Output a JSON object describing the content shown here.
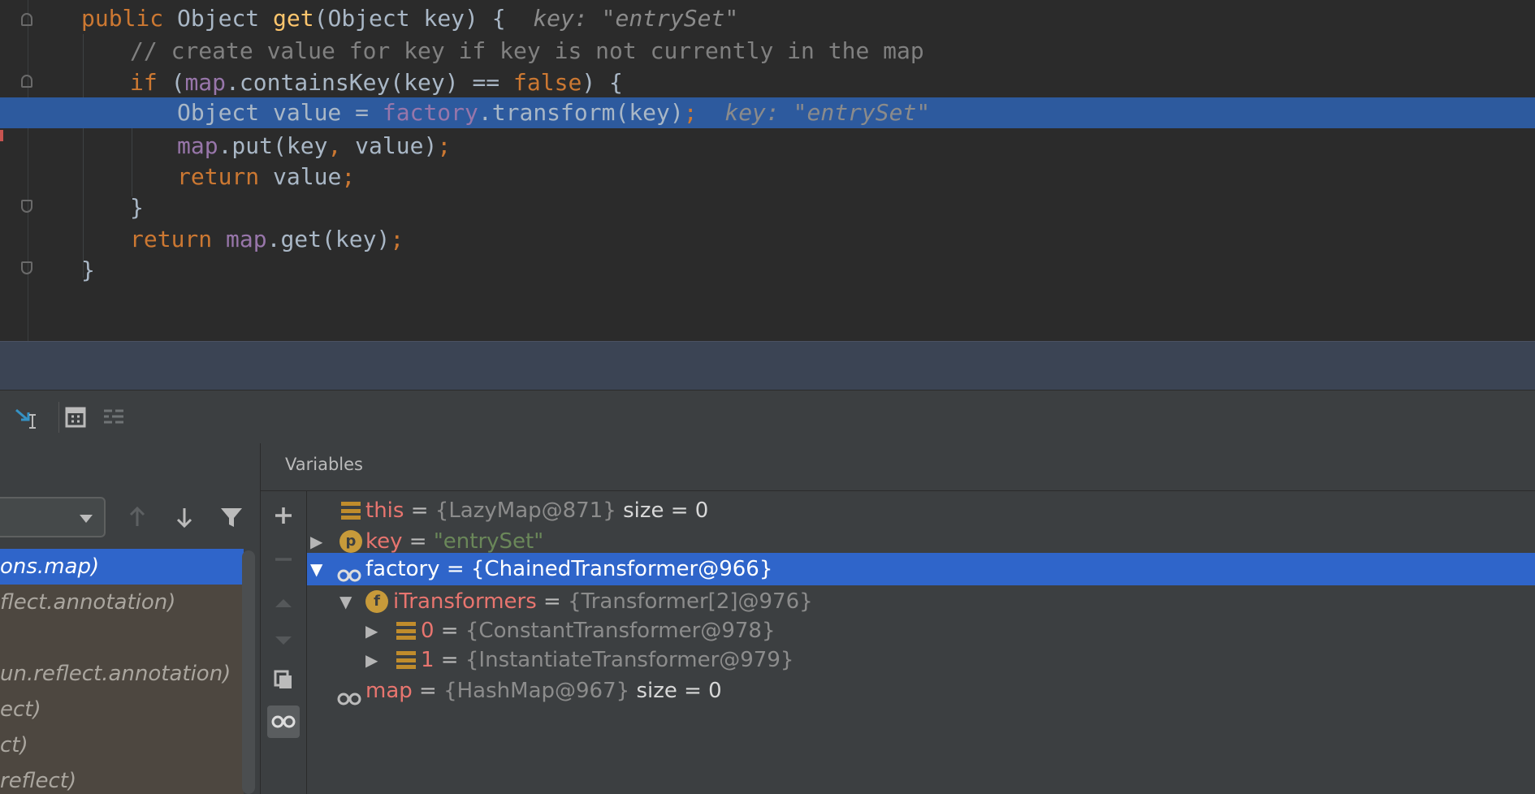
{
  "editor": {
    "lines": [
      {
        "tokens": [
          {
            "t": "public ",
            "c": "kw"
          },
          {
            "t": "Object ",
            "c": ""
          },
          {
            "t": "get",
            "c": "fn"
          },
          {
            "t": "(Object key) {  ",
            "c": ""
          },
          {
            "t": "key: \"entrySet\"",
            "c": "hint"
          }
        ]
      },
      {
        "tokens": [
          {
            "t": "// create value for key if key is not currently in the map",
            "c": "cmt"
          }
        ]
      },
      {
        "tokens": [
          {
            "t": "if ",
            "c": "kw"
          },
          {
            "t": "(",
            "c": ""
          },
          {
            "t": "map",
            "c": "fld"
          },
          {
            "t": ".containsKey(key) == ",
            "c": ""
          },
          {
            "t": "false",
            "c": "kw"
          },
          {
            "t": ") {",
            "c": ""
          }
        ]
      },
      {
        "tokens": [
          {
            "t": "Object value = ",
            "c": ""
          },
          {
            "t": "factory",
            "c": "fld"
          },
          {
            "t": ".transform(key)",
            "c": ""
          },
          {
            "t": ";",
            "c": "kw"
          },
          {
            "t": "  ",
            "c": ""
          },
          {
            "t": "key: \"entrySet\"",
            "c": "hint"
          }
        ]
      },
      {
        "tokens": [
          {
            "t": "map",
            "c": "fld"
          },
          {
            "t": ".put(key",
            "c": ""
          },
          {
            "t": ",",
            "c": "kw"
          },
          {
            "t": " value)",
            "c": ""
          },
          {
            "t": ";",
            "c": "kw"
          }
        ]
      },
      {
        "tokens": [
          {
            "t": "return ",
            "c": "kw"
          },
          {
            "t": "value",
            "c": ""
          },
          {
            "t": ";",
            "c": "kw"
          }
        ]
      },
      {
        "tokens": [
          {
            "t": "}",
            "c": ""
          }
        ]
      },
      {
        "tokens": [
          {
            "t": "return ",
            "c": "kw"
          },
          {
            "t": "map",
            "c": "fld"
          },
          {
            "t": ".get(key)",
            "c": ""
          },
          {
            "t": ";",
            "c": "kw"
          }
        ]
      },
      {
        "tokens": [
          {
            "t": "}",
            "c": ""
          }
        ]
      }
    ]
  },
  "frames": {
    "items": [
      "ons.map)",
      "flect.annotation)",
      "",
      "un.reflect.annotation)",
      "ect)",
      "ct)",
      "reflect)"
    ]
  },
  "variables": {
    "title": "Variables",
    "rows": [
      {
        "icon": "field-list-icon",
        "name": "this",
        "op": " = ",
        "value": "{LazyMap@871}",
        "extra": "  size = 0",
        "str": false
      },
      {
        "icon": "parameter-icon",
        "name": "key",
        "op": " = ",
        "value": "\"entrySet\"",
        "extra": "",
        "str": true
      },
      {
        "icon": "watch-icon",
        "name": "factory",
        "op": " = ",
        "value": "{ChainedTransformer@966}",
        "extra": "",
        "str": false
      },
      {
        "icon": "field-icon",
        "name": "iTransformers",
        "op": " = ",
        "value": "{Transformer[2]@976}",
        "extra": "",
        "str": false
      },
      {
        "icon": "field-list-icon",
        "name": "0",
        "op": " = ",
        "value": "{ConstantTransformer@978}",
        "extra": "",
        "str": false
      },
      {
        "icon": "field-list-icon",
        "name": "1",
        "op": " = ",
        "value": "{InstantiateTransformer@979}",
        "extra": "",
        "str": false
      },
      {
        "icon": "watch-icon",
        "name": "map",
        "op": " = ",
        "value": "{HashMap@967}",
        "extra": "  size = 0",
        "str": false
      }
    ]
  },
  "colors": {
    "accent_selection": "#2f65ca",
    "current_line": "#2d5a9e",
    "keyword": "#cc7832",
    "field": "#9876aa",
    "var_name": "#e8756f"
  }
}
